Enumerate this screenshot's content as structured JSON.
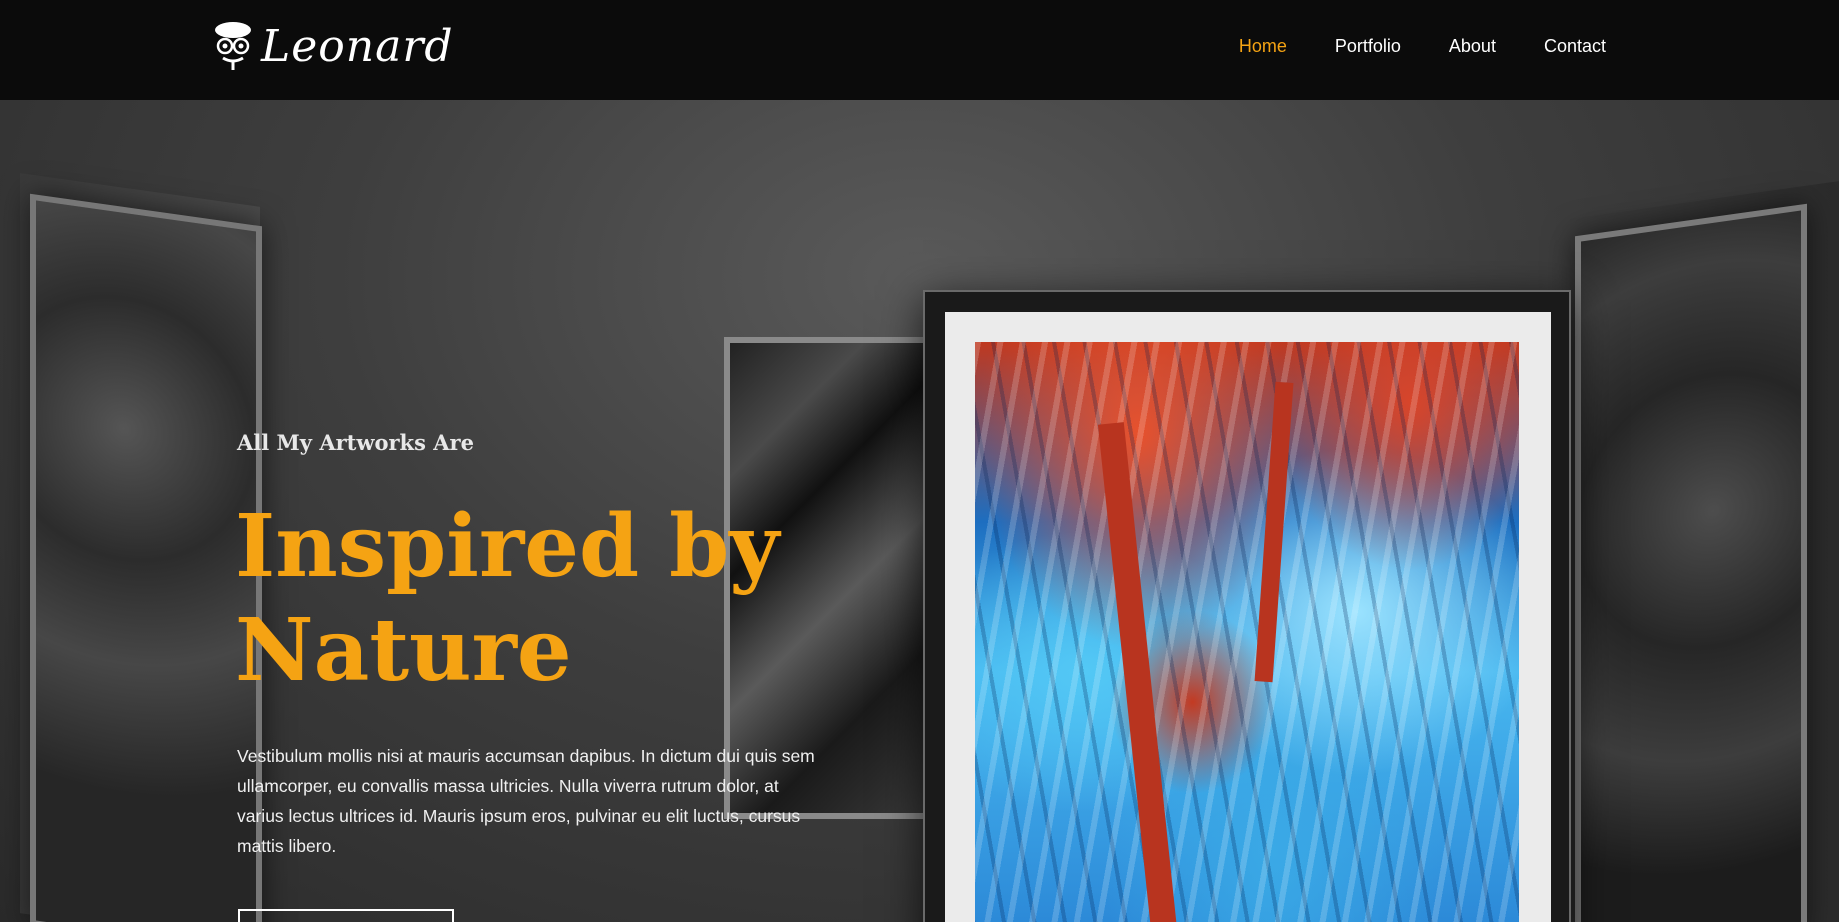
{
  "brand": {
    "name": "Leonard"
  },
  "nav": {
    "items": [
      {
        "label": "Home",
        "active": true
      },
      {
        "label": "Portfolio",
        "active": false
      },
      {
        "label": "About",
        "active": false
      },
      {
        "label": "Contact",
        "active": false
      }
    ]
  },
  "hero": {
    "kicker": "All My Artworks Are",
    "headline_line1": "Inspired by",
    "headline_line2": "Nature",
    "description": "Vestibulum mollis nisi at mauris accumsan dapibus. In dictum dui quis sem ullamcorper, eu convallis massa ultricies. Nulla viverra rutrum dolor, at varius lectus ultrices id. Mauris ipsum eros, pulvinar eu elit luctus, cursus mattis libero."
  },
  "colors": {
    "accent": "#f5a313",
    "header_bg": "#0b0b0b",
    "text": "#ffffff"
  },
  "icons": {
    "logo": "artist-face-icon"
  }
}
